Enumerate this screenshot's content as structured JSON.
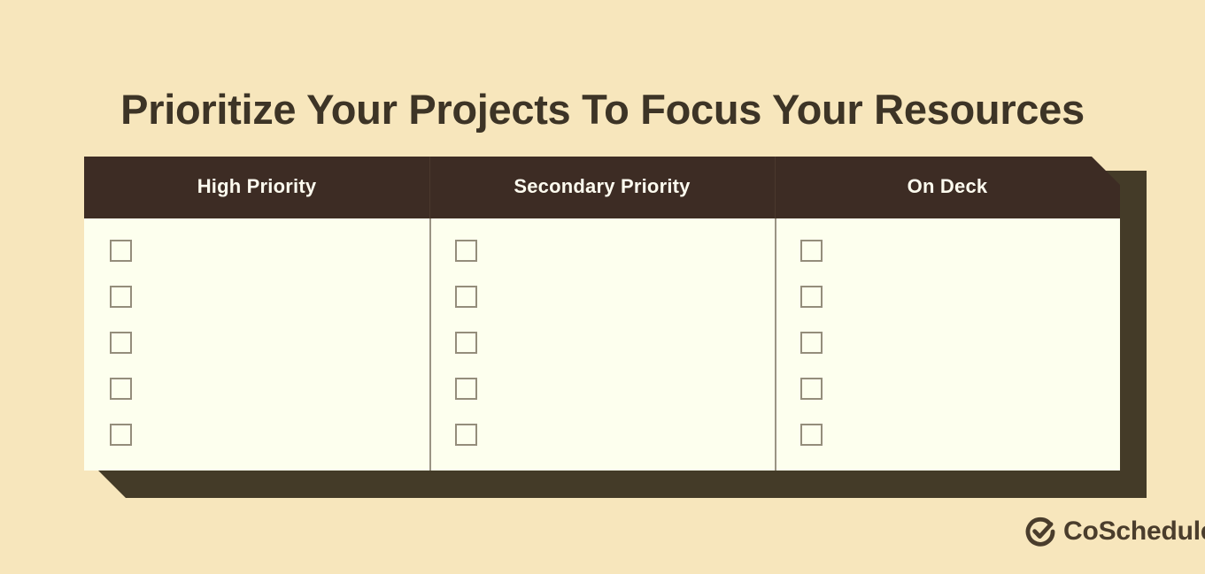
{
  "page": {
    "title": "Prioritize Your Projects To Focus Your Resources",
    "background_color": "#f7e6bc",
    "title_color": "#3d3426"
  },
  "table": {
    "header_color": "#3d2c24",
    "shadow_color": "#443b28",
    "body_color": "#fdffee",
    "divider_color": "#9a9484",
    "checkbox_border_color": "#948d7b",
    "columns": [
      {
        "header": "High Priority",
        "rows": [
          "",
          "",
          "",
          "",
          ""
        ]
      },
      {
        "header": "Secondary Priority",
        "rows": [
          "",
          "",
          "",
          "",
          ""
        ]
      },
      {
        "header": "On Deck",
        "rows": [
          "",
          "",
          "",
          "",
          ""
        ]
      }
    ]
  },
  "branding": {
    "name": "CoSchedule",
    "mark_icon": "coschedule-check-circle-icon",
    "color": "#4a3d2c"
  }
}
